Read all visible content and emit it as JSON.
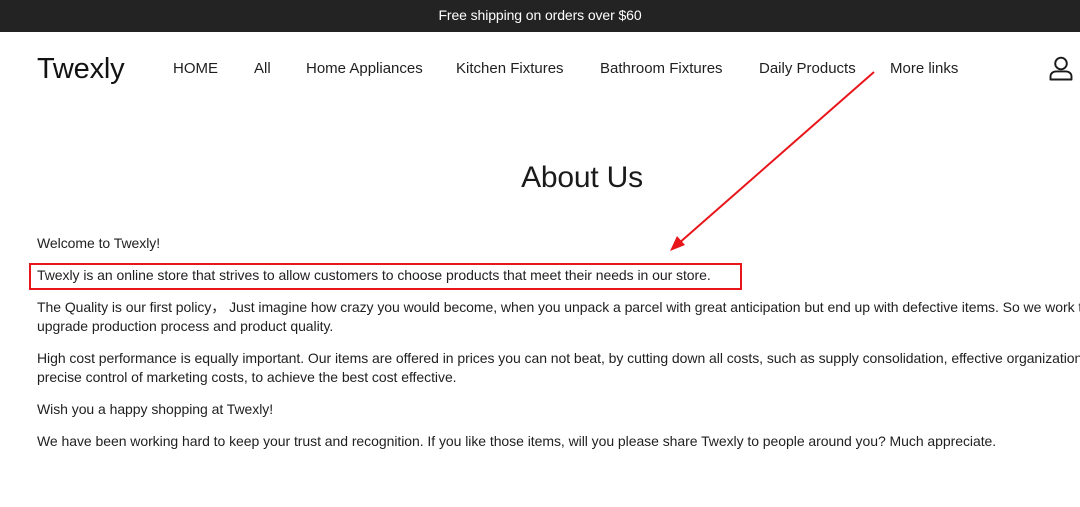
{
  "announcement": {
    "text": "Free shipping on orders over $60"
  },
  "header": {
    "logo": "Twexly",
    "nav": [
      {
        "label": "HOME"
      },
      {
        "label": "All"
      },
      {
        "label": "Home Appliances"
      },
      {
        "label": "Kitchen Fixtures"
      },
      {
        "label": "Bathroom Fixtures"
      },
      {
        "label": "Daily Products"
      },
      {
        "label": "More links"
      }
    ],
    "account_icon": "account-icon"
  },
  "main": {
    "title": "About Us",
    "paragraphs": [
      "Welcome to Twexly!",
      "Twexly is an online store that strives to allow customers to choose products that meet their needs in our store.",
      "The Quality is our first policy，  Just imagine how crazy you would become, when you unpack a parcel with great anticipation but end up with defective items. So we work to endlessly upgrade production process and product quality.",
      "High cost performance is equally important. Our items are offered in prices you can not beat, by cutting down all costs, such as supply consolidation, effective organization structure, precise control of marketing costs, to achieve the best cost effective.",
      "Wish you a happy shopping at Twexly!",
      "We have been working hard to keep your trust and recognition. If you like those items, will you please share Twexly to people around you? Much appreciate."
    ]
  },
  "annotation": {
    "color": "#e8161b"
  }
}
